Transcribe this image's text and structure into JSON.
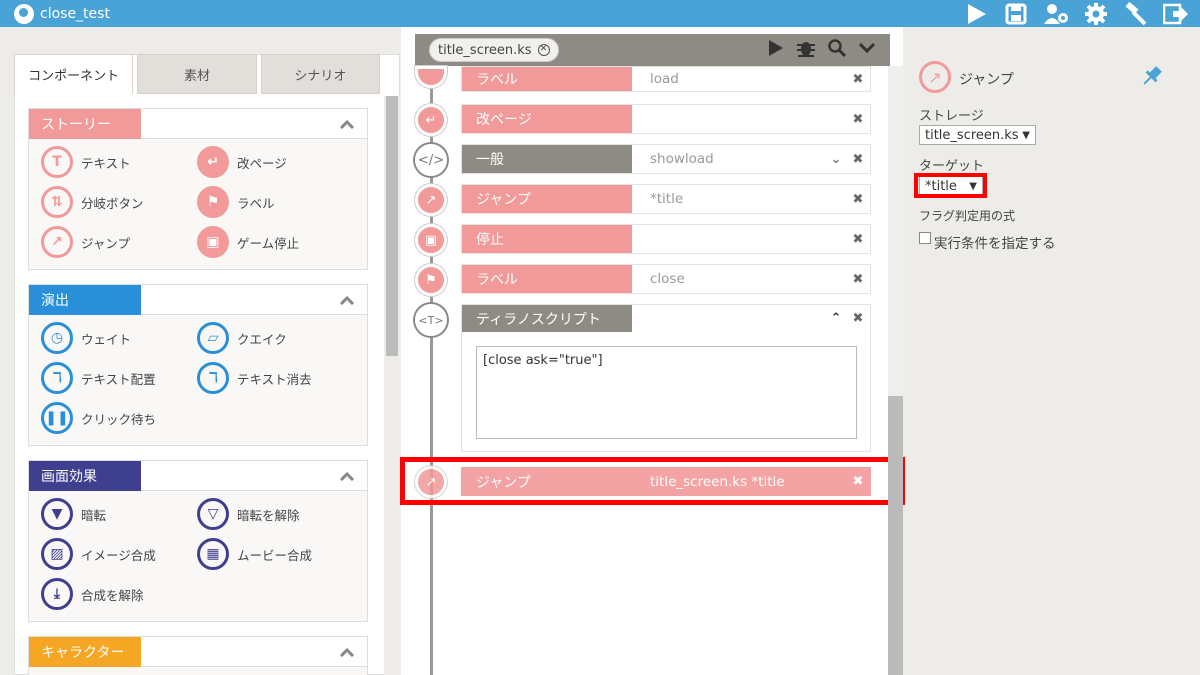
{
  "app": {
    "title": "close_test"
  },
  "toolbar": {
    "icons": [
      "play-icon",
      "save-icon",
      "users-gear-icon",
      "gear-icon",
      "hammer-icon",
      "exit-icon"
    ]
  },
  "left": {
    "tabs": [
      "コンポーネント",
      "素材",
      "シナリオ"
    ],
    "categories": [
      {
        "name": "ストーリー",
        "color": "#f29a9a",
        "items": [
          "テキスト",
          "改ページ",
          "分岐ボタン",
          "ラベル",
          "ジャンプ",
          "ゲーム停止"
        ]
      },
      {
        "name": "演出",
        "color": "#2a8fd9",
        "items": [
          "ウェイト",
          "クエイク",
          "テキスト配置",
          "テキスト消去",
          "クリック待ち"
        ]
      },
      {
        "name": "画面効果",
        "color": "#3f3f8f",
        "items": [
          "暗転",
          "暗転を解除",
          "イメージ合成",
          "ムービー合成",
          "合成を解除"
        ]
      },
      {
        "name": "キャラクター",
        "color": "#f5a623",
        "items": []
      }
    ]
  },
  "center": {
    "file_tab": "title_screen.ks",
    "rows": [
      {
        "name": "ラベル",
        "value": "load",
        "color": "#f29a9a"
      },
      {
        "name": "改ページ",
        "value": "",
        "color": "#f29a9a"
      },
      {
        "name": "一般",
        "value": "showload",
        "color": "#8e8b84"
      },
      {
        "name": "ジャンプ",
        "value": "*title",
        "color": "#f29a9a"
      },
      {
        "name": "停止",
        "value": "",
        "color": "#f29a9a"
      },
      {
        "name": "ラベル",
        "value": "close",
        "color": "#f29a9a"
      },
      {
        "name": "ティラノスクリプト",
        "value": "",
        "color": "#8e8b84"
      }
    ],
    "script_text": "[close ask=\"true\"]",
    "selected_row": {
      "name": "ジャンプ",
      "value": "title_screen.ks *title"
    }
  },
  "right": {
    "title": "ジャンプ",
    "storage_label": "ストレージ",
    "storage_value": "title_screen.ks",
    "target_label": "ターゲット",
    "target_value": "*title",
    "flag_label": "フラグ判定用の式",
    "cond_label": "実行条件を指定する"
  }
}
